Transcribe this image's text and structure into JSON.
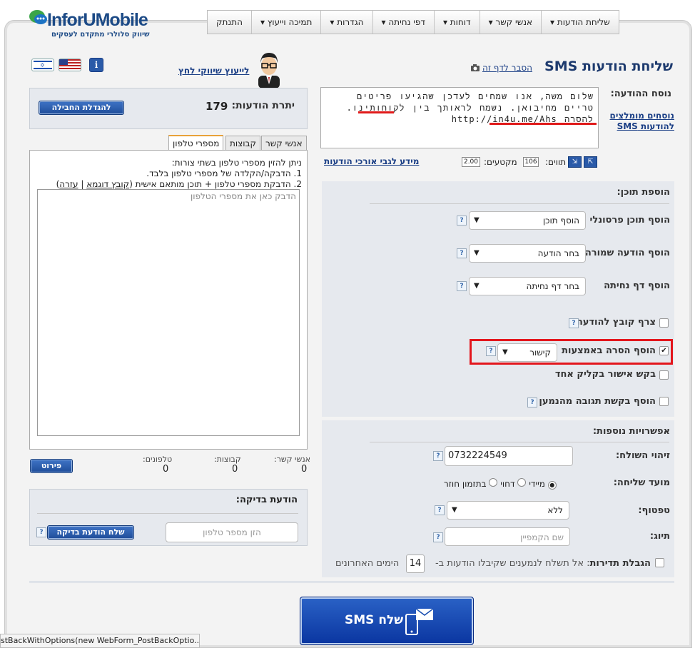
{
  "nav": {
    "items": [
      "שליחת הודעות ▾",
      "אנשי קשר ▾",
      "דוחות ▾",
      "דפי נחיתה ▾",
      "הגדרות ▾",
      "תמיכה וייעוץ ▾",
      "התנתק"
    ]
  },
  "logo": {
    "brand": "InforUMobile",
    "tagline": "שיווק סלולרי מתקדם לעסקים"
  },
  "header": {
    "page_title": "שליחת הודעות SMS",
    "explain_link": "הסבר לדף זה",
    "advisor_link": "לייעוץ שיווקי לחץ",
    "info_icon": "i"
  },
  "message": {
    "label": "נוסח ההודעה:",
    "text": "שלום משה, אנו שמחים לעדכן שהגיעו פריטים טריים מחיבואן. נשמח לראותך בין לקוחותינו. להסרה http://in4u.me/Ahs",
    "recommended_link": "נוסחים מומלצים להודעות SMS",
    "chars_label": "תווים:",
    "chars_value": "106",
    "segments_label": "מקטעים:",
    "segments_value": "2.00",
    "long_msgs_link": "מידע לגבי אורכי הודעות"
  },
  "balance": {
    "label": "יתרת הודעות:",
    "value": "179",
    "upgrade_button": "להגדלת החבילה"
  },
  "recipients": {
    "tabs": [
      "מספרי טלפון",
      "קבוצות",
      "אנשי קשר"
    ],
    "instruction_1": "ניתן להזין מספרי טלפון בשתי צורות:",
    "instruction_2": "1. הדבקה/הקלדה של מספרי טלפון בלבד.",
    "instruction_3_prefix": "2. הדבקת מספרי טלפון + תוכן מותאם אישית (",
    "sample_file_link": "קובץ דוגמא",
    "separator": "|",
    "help_link": "עזרה",
    "instruction_3_suffix": ")",
    "textarea_placeholder": "הדבק כאן את מספרי הטלפון",
    "contacts_label": "אנשי קשר:",
    "contacts_value": "0",
    "groups_label": "קבוצות:",
    "groups_value": "0",
    "phones_label": "טלפונים:",
    "phones_value": "0",
    "breakdown_button": "פירוט"
  },
  "test_message": {
    "label": "הודעת בדיקה:",
    "phone_placeholder": "הזן מספר טלפון",
    "send_button": "שלח הודעת בדיקה"
  },
  "add_content": {
    "title": "הוספת תוכן:",
    "personal_label": "הוסף תוכן פרסונלי",
    "personal_value": "הוסף תוכן",
    "saved_label": "הוסף הודעה שמורה",
    "saved_value": "בחר הודעה",
    "landing_label": "הוסף דף נחיתה",
    "landing_value": "בחר דף נחיתה",
    "attach_label": "צרף קובץ להודעה",
    "unsubscribe_label": "הוסף הסרה באמצעות",
    "unsubscribe_value": "קישור",
    "one_click_label": "בקש אישור בקליק אחד",
    "response_label": "הוסף בקשת תגובה מהנמען"
  },
  "options": {
    "title": "אפשרויות נוספות:",
    "sender_label": "זיהוי השולח:",
    "sender_value": "0732224549",
    "schedule_label": "מועד שליחה:",
    "schedule_now": "מיידי",
    "schedule_delay": "דחוי",
    "schedule_recurring": "בתזמון חוזר",
    "template_label": "טפטוף:",
    "template_value": "ללא",
    "tag_label": "תיוג:",
    "tag_placeholder": "שם הקמפיין",
    "frequency_bold": "הגבלת תדירות",
    "frequency_text": ": אל תשלח לנמענים שקיבלו הודעות ב-",
    "frequency_days": "14",
    "frequency_suffix": "הימים האחרונים"
  },
  "send": {
    "button": "שלח SMS"
  },
  "status_bar": {
    "text": "stBackWithOptions(new WebForm_PostBackOptio..."
  }
}
